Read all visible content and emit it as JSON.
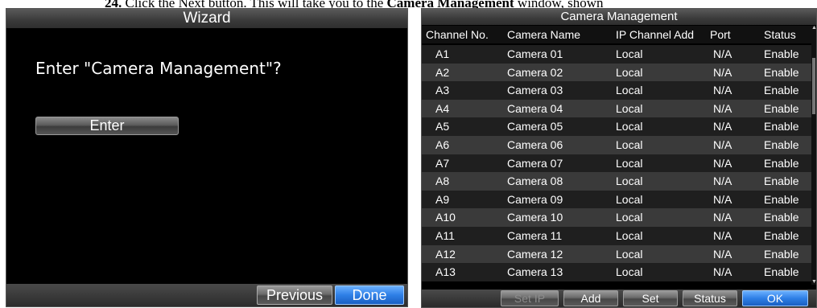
{
  "document": {
    "line_parts": [
      "24.",
      " Click the Next button. This will take you to the ",
      "Camera Management",
      " window, shown"
    ]
  },
  "wizard": {
    "title": "Wizard",
    "question": "Enter \"Camera Management\"?",
    "enter_label": "Enter",
    "previous_label": "Previous",
    "done_label": "Done"
  },
  "camera_management": {
    "title": "Camera Management",
    "columns": [
      "Channel No.",
      "Camera Name",
      "IP Channel Add",
      "Port",
      "Status"
    ],
    "rows": [
      {
        "channel": "A1",
        "name": "Camera 01",
        "ip": "Local",
        "port": "N/A",
        "status": "Enable"
      },
      {
        "channel": "A2",
        "name": "Camera 02",
        "ip": "Local",
        "port": "N/A",
        "status": "Enable"
      },
      {
        "channel": "A3",
        "name": "Camera 03",
        "ip": "Local",
        "port": "N/A",
        "status": "Enable"
      },
      {
        "channel": "A4",
        "name": "Camera 04",
        "ip": "Local",
        "port": "N/A",
        "status": "Enable"
      },
      {
        "channel": "A5",
        "name": "Camera 05",
        "ip": "Local",
        "port": "N/A",
        "status": "Enable"
      },
      {
        "channel": "A6",
        "name": "Camera 06",
        "ip": "Local",
        "port": "N/A",
        "status": "Enable"
      },
      {
        "channel": "A7",
        "name": "Camera 07",
        "ip": "Local",
        "port": "N/A",
        "status": "Enable"
      },
      {
        "channel": "A8",
        "name": "Camera 08",
        "ip": "Local",
        "port": "N/A",
        "status": "Enable"
      },
      {
        "channel": "A9",
        "name": "Camera 09",
        "ip": "Local",
        "port": "N/A",
        "status": "Enable"
      },
      {
        "channel": "A10",
        "name": "Camera 10",
        "ip": "Local",
        "port": "N/A",
        "status": "Enable"
      },
      {
        "channel": "A11",
        "name": "Camera 11",
        "ip": "Local",
        "port": "N/A",
        "status": "Enable"
      },
      {
        "channel": "A12",
        "name": "Camera 12",
        "ip": "Local",
        "port": "N/A",
        "status": "Enable"
      },
      {
        "channel": "A13",
        "name": "Camera 13",
        "ip": "Local",
        "port": "N/A",
        "status": "Enable"
      }
    ],
    "buttons": {
      "set_ip": "Set IP",
      "add": "Add",
      "set": "Set",
      "status": "Status",
      "ok": "OK"
    }
  }
}
